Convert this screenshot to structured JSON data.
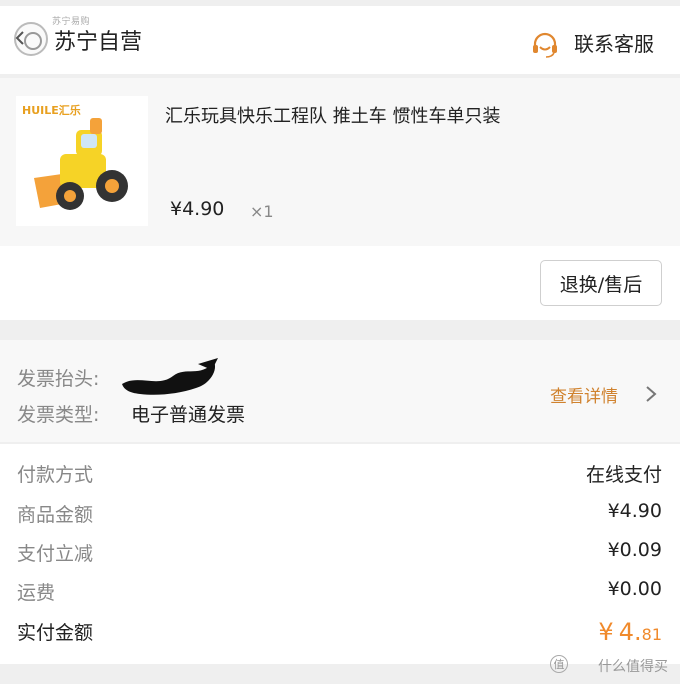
{
  "store": {
    "name": "苏宁自营",
    "watermark": "苏宁易购",
    "customer_service": "联系客服"
  },
  "product": {
    "brand_logo": "HUILE汇乐",
    "title": "汇乐玩具快乐工程队 推土车 惯性车单只装",
    "price": "¥4.90",
    "qty": "×1",
    "image_icon": "toy-bulldozer"
  },
  "after_sale": {
    "button_label": "退换/售后"
  },
  "invoice": {
    "title_label": "发票抬头:",
    "type_label": "发票类型:",
    "type_value": "电子普通发票",
    "detail_link": "查看详情"
  },
  "payment": {
    "rows": [
      {
        "label": "付款方式",
        "value": "在线支付"
      },
      {
        "label": "商品金额",
        "value": "¥4.90"
      },
      {
        "label": "支付立减",
        "value": "¥0.09"
      },
      {
        "label": "运费",
        "value": "¥0.00"
      }
    ],
    "total_label": "实付金额",
    "total_currency": "¥",
    "total_int": "4.",
    "total_dec": "81"
  },
  "footer": {
    "watermark_badge": "值",
    "watermark_text": "什么值得买"
  },
  "colors": {
    "accent": "#d0822e",
    "total": "#f08a2c"
  }
}
